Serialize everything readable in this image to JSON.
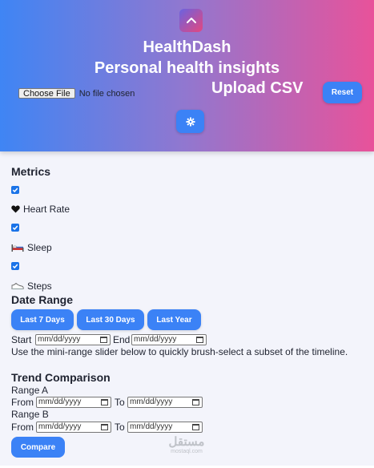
{
  "header": {
    "title": "HealthDash",
    "subtitle": "Personal health insights",
    "file_button": "Choose File",
    "file_status": "No file chosen",
    "upload_label": "Upload CSV",
    "reset_label": "Reset",
    "logo_icon": "chevron-up-icon",
    "theme_icon": "gear-icon"
  },
  "metrics": {
    "heading": "Metrics",
    "items": [
      {
        "label": "Heart Rate",
        "icon": "heart-icon",
        "checked": true
      },
      {
        "label": "Sleep",
        "icon": "bed-icon",
        "checked": true
      },
      {
        "label": "Steps",
        "icon": "shoe-icon",
        "checked": true
      }
    ]
  },
  "date_range": {
    "heading": "Date Range",
    "buttons": [
      "Last 7 Days",
      "Last 30 Days",
      "Last Year"
    ],
    "start_label": "Start",
    "end_label": "End",
    "placeholder": "mm/dd/yyyy",
    "hint": "Use the mini-range slider below to quickly brush-select a subset of the timeline."
  },
  "trend": {
    "heading": "Trend Comparison",
    "range_a": "Range A",
    "range_b": "Range B",
    "from_label": "From",
    "to_label": "To",
    "compare_label": "Compare"
  },
  "watermark": {
    "main": "مستقل",
    "sub": "mostaql.com"
  },
  "colors": {
    "accent": "#3b82f6",
    "gradient_start": "#3f85f4",
    "gradient_end": "#e8529a",
    "checkbox": "#1a73e8"
  }
}
